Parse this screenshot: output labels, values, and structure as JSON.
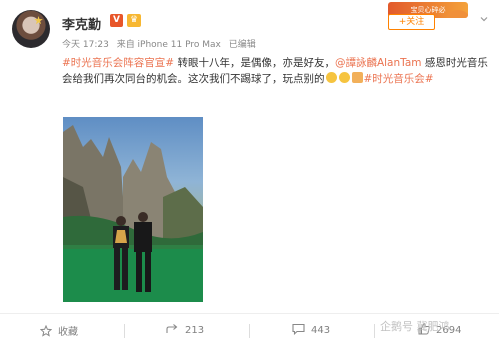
{
  "user": {
    "name": "李克勤",
    "badges": [
      "V",
      "♛"
    ]
  },
  "meta": {
    "time": "今天 17:23",
    "source": "来自 iPhone 11 Pro Max",
    "edited": "已编辑"
  },
  "ad_banner": "宝贝心碎必",
  "follow": {
    "label": "+关注"
  },
  "post": {
    "hashtag1": "#时光音乐会阵容官宣#",
    "text1": " 转眼十八年，是偶像，亦是好友，",
    "mention": "@譚詠麟AlanTam",
    "text2": " 感恩时光音乐会给我们再次同台的机会。这次我们不踢球了，玩点别的",
    "hashtag2": "#时光音乐会#"
  },
  "actions": {
    "favorite": "收藏",
    "forward_count": "213",
    "comment_count": "443",
    "like_count": "2694"
  },
  "watermark": "企鹅号 冀肥鸿",
  "colors": {
    "accent": "#eb7350",
    "follow": "#ff8200",
    "muted": "#808080"
  }
}
